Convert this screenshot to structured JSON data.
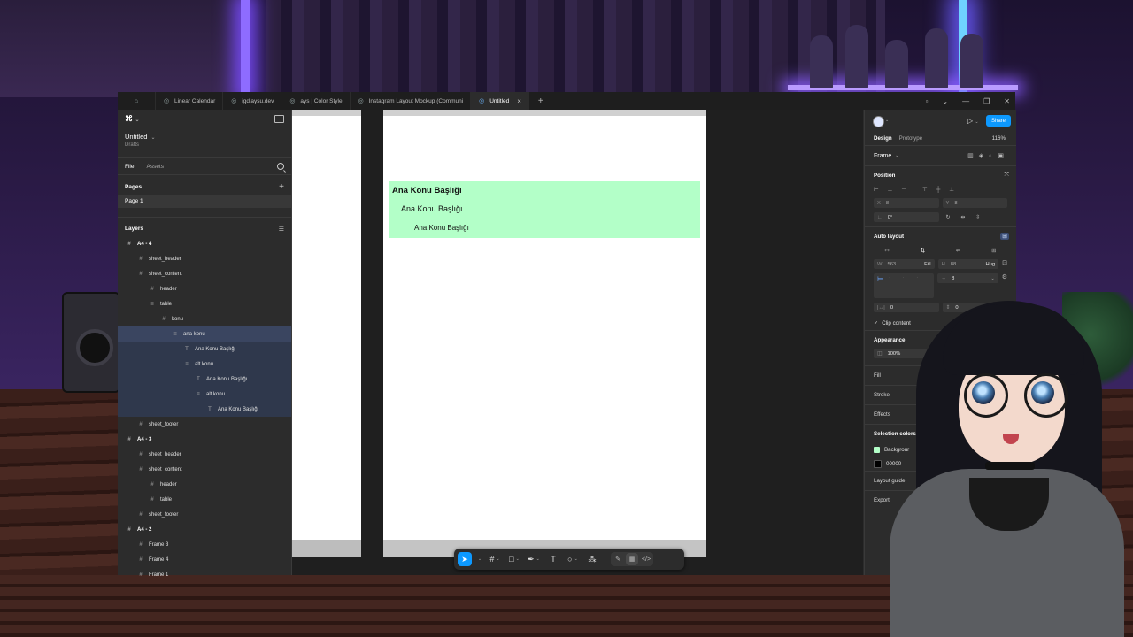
{
  "tabs": [
    {
      "label": "Linear Calendar",
      "icon": "figma-file-icon"
    },
    {
      "label": "igdiaysu.dev",
      "icon": "figma-file-icon"
    },
    {
      "label": "ays | Color Style",
      "icon": "figma-file-icon"
    },
    {
      "label": "Instagram Layout Mockup (Communi",
      "icon": "figma-file-icon"
    },
    {
      "label": "Untitled",
      "icon": "figma-file-icon",
      "active": true
    }
  ],
  "file": {
    "title": "Untitled",
    "subtitle": "Drafts"
  },
  "left_tabs": {
    "file": "File",
    "assets": "Assets"
  },
  "pages": {
    "heading": "Pages",
    "items": [
      "Page 1"
    ]
  },
  "layers": {
    "heading": "Layers",
    "items": [
      {
        "label": "A4 - 4",
        "depth": 0,
        "bold": true,
        "icon": "#",
        "state": ""
      },
      {
        "label": "sheet_header",
        "depth": 1,
        "icon": "#",
        "state": ""
      },
      {
        "label": "sheet_content",
        "depth": 1,
        "icon": "#",
        "state": ""
      },
      {
        "label": "header",
        "depth": 2,
        "icon": "#",
        "state": ""
      },
      {
        "label": "table",
        "depth": 2,
        "icon": "≡",
        "state": ""
      },
      {
        "label": "konu",
        "depth": 3,
        "icon": "#",
        "state": ""
      },
      {
        "label": "ana konu",
        "depth": 4,
        "icon": "≡",
        "state": "selected"
      },
      {
        "label": "Ana Konu Başlığı",
        "depth": 5,
        "icon": "T",
        "state": "child"
      },
      {
        "label": "alt konu",
        "depth": 5,
        "icon": "≡",
        "state": "child"
      },
      {
        "label": "Ana Konu Başlığı",
        "depth": 6,
        "icon": "T",
        "state": "child"
      },
      {
        "label": "alt konu",
        "depth": 6,
        "icon": "≡",
        "state": "child"
      },
      {
        "label": "Ana Konu Başlığı",
        "depth": 7,
        "icon": "T",
        "state": "child"
      },
      {
        "label": "sheet_footer",
        "depth": 1,
        "icon": "#",
        "state": ""
      },
      {
        "label": "A4 - 3",
        "depth": 0,
        "bold": true,
        "icon": "#",
        "state": ""
      },
      {
        "label": "sheet_header",
        "depth": 1,
        "icon": "#",
        "state": ""
      },
      {
        "label": "sheet_content",
        "depth": 1,
        "icon": "#",
        "state": ""
      },
      {
        "label": "header",
        "depth": 2,
        "icon": "#",
        "state": ""
      },
      {
        "label": "table",
        "depth": 2,
        "icon": "#",
        "state": ""
      },
      {
        "label": "sheet_footer",
        "depth": 1,
        "icon": "#",
        "state": ""
      },
      {
        "label": "A4 - 2",
        "depth": 0,
        "bold": true,
        "icon": "#",
        "state": ""
      },
      {
        "label": "Frame 3",
        "depth": 1,
        "icon": "#",
        "state": ""
      },
      {
        "label": "Frame 4",
        "depth": 1,
        "icon": "#",
        "state": ""
      },
      {
        "label": "Frame 1",
        "depth": 1,
        "icon": "#",
        "state": ""
      }
    ]
  },
  "canvas": {
    "heading1": "Ana Konu Başlığı",
    "heading2": "Ana Konu Başlığı",
    "heading3": "Ana Konu Başlığı",
    "box_color": "#b3ffc8"
  },
  "right": {
    "share": "Share",
    "tab_design": "Design",
    "tab_prototype": "Prototype",
    "zoom": "116%",
    "frame_label": "Frame",
    "position": {
      "heading": "Position",
      "x_label": "X",
      "x_value": "8",
      "y_label": "Y",
      "y_value": "8",
      "rotation": "0°"
    },
    "auto_layout": {
      "heading": "Auto layout",
      "w_label": "W",
      "w_value": "563",
      "w_mode": "Fill",
      "h_label": "H",
      "h_value": "88",
      "h_mode": "Hug",
      "gap": "8",
      "pad_h": "0",
      "pad_v": "0",
      "clip": "Clip content"
    },
    "appearance": {
      "heading": "Appearance",
      "opacity": "100%"
    },
    "fill": "Fill",
    "stroke": "Stroke",
    "effects": "Effects",
    "selection_colors": {
      "heading": "Selection colors",
      "items": [
        {
          "label": "Backgrour",
          "color": "#b3ffc8"
        },
        {
          "label": "00000",
          "color": "#000000"
        }
      ]
    },
    "layout_guide": "Layout guide",
    "export": "Export"
  }
}
